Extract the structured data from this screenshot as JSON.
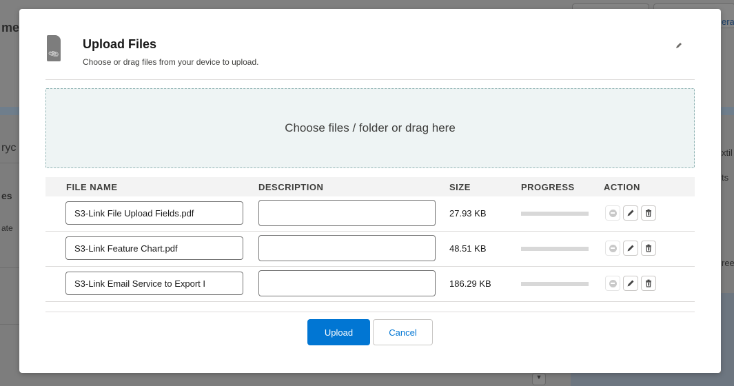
{
  "background": {
    "left_text_1": "me",
    "left_text_2": "ryc",
    "left_text_3": "es",
    "left_text_4": "ate",
    "right_link": "era",
    "right_text_1": "xtil",
    "right_text_2": "ts",
    "right_text_3": "ree",
    "scroll_arrow": "▼"
  },
  "modal": {
    "title": "Upload Files",
    "subtitle": "Choose or drag files from your device to upload.",
    "header_icon": "attachment-document-icon",
    "dropzone_text": "Choose files / folder or drag here",
    "columns": [
      "FILE NAME",
      "DESCRIPTION",
      "SIZE",
      "PROGRESS",
      "ACTION"
    ],
    "files": [
      {
        "name": "S3-Link File Upload Fields.pdf",
        "description": "",
        "size": "27.93 KB",
        "progress": 0
      },
      {
        "name": "S3-Link Feature Chart.pdf",
        "description": "",
        "size": "48.51 KB",
        "progress": 0
      },
      {
        "name": "S3-Link Email Service to Export I",
        "description": "",
        "size": "186.29 KB",
        "progress": 0
      }
    ],
    "upload_label": "Upload",
    "cancel_label": "Cancel",
    "colors": {
      "brand": "#0176d3",
      "dropzone_bg": "#eef4f4",
      "progress_track": "#d8d8d8"
    }
  }
}
